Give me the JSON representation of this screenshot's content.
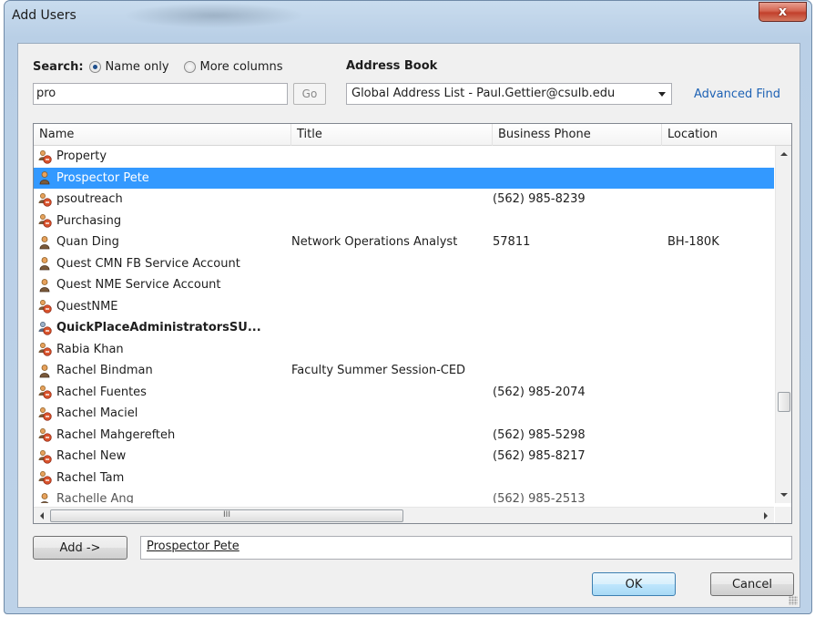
{
  "window": {
    "title": "Add Users",
    "close_label": "x"
  },
  "search": {
    "label": "Search:",
    "option_name_only": "Name only",
    "option_more_columns": "More columns",
    "selected_option": "Name only",
    "value": "pro",
    "go_label": "Go"
  },
  "address_book": {
    "label": "Address Book",
    "value": "Global Address List - Paul.Gettier@csulb.edu",
    "advanced_find": "Advanced Find"
  },
  "table": {
    "columns": [
      "Name",
      "Title",
      "Business Phone",
      "Location"
    ],
    "rows": [
      {
        "name": "Property",
        "title": "",
        "phone": "",
        "location": "",
        "icon": "group-icon",
        "selected": false,
        "bold": false
      },
      {
        "name": "Prospector Pete",
        "title": "",
        "phone": "",
        "location": "",
        "icon": "user-icon",
        "selected": true,
        "bold": false
      },
      {
        "name": "psoutreach",
        "title": "",
        "phone": "(562) 985-8239",
        "location": "",
        "icon": "group-icon",
        "selected": false,
        "bold": false
      },
      {
        "name": "Purchasing",
        "title": "",
        "phone": "",
        "location": "",
        "icon": "group-icon",
        "selected": false,
        "bold": false
      },
      {
        "name": "Quan Ding",
        "title": "Network Operations Analyst",
        "phone": "57811",
        "location": "BH-180K",
        "icon": "user-icon",
        "selected": false,
        "bold": false
      },
      {
        "name": "Quest CMN FB Service Account",
        "title": "",
        "phone": "",
        "location": "",
        "icon": "user-icon",
        "selected": false,
        "bold": false
      },
      {
        "name": "Quest NME Service Account",
        "title": "",
        "phone": "",
        "location": "",
        "icon": "user-icon",
        "selected": false,
        "bold": false
      },
      {
        "name": "QuestNME",
        "title": "",
        "phone": "",
        "location": "",
        "icon": "group-icon",
        "selected": false,
        "bold": false
      },
      {
        "name": "QuickPlaceAdministratorsSU...",
        "title": "",
        "phone": "",
        "location": "",
        "icon": "distribution-list-icon",
        "selected": false,
        "bold": true
      },
      {
        "name": "Rabia Khan",
        "title": "",
        "phone": "",
        "location": "",
        "icon": "group-icon",
        "selected": false,
        "bold": false
      },
      {
        "name": "Rachel Bindman",
        "title": "Faculty Summer Session-CED",
        "phone": "",
        "location": "",
        "icon": "user-icon",
        "selected": false,
        "bold": false
      },
      {
        "name": "Rachel Fuentes",
        "title": "",
        "phone": "(562) 985-2074",
        "location": "",
        "icon": "group-icon",
        "selected": false,
        "bold": false
      },
      {
        "name": "Rachel Maciel",
        "title": "",
        "phone": "",
        "location": "",
        "icon": "group-icon",
        "selected": false,
        "bold": false
      },
      {
        "name": "Rachel Mahgerefteh",
        "title": "",
        "phone": "(562) 985-5298",
        "location": "",
        "icon": "group-icon",
        "selected": false,
        "bold": false
      },
      {
        "name": "Rachel New",
        "title": "",
        "phone": "(562) 985-8217",
        "location": "",
        "icon": "group-icon",
        "selected": false,
        "bold": false
      },
      {
        "name": "Rachel Tam",
        "title": "",
        "phone": "",
        "location": "",
        "icon": "group-icon",
        "selected": false,
        "bold": false
      },
      {
        "name": "Rachelle Ang",
        "title": "",
        "phone": "(562) 985-2513",
        "location": "",
        "icon": "user-icon",
        "selected": false,
        "bold": false
      }
    ]
  },
  "hscroll_grip": "III",
  "add": {
    "button_label": "Add ->",
    "value": "Prospector Pete"
  },
  "buttons": {
    "ok": "OK",
    "cancel": "Cancel"
  },
  "colors": {
    "selection": "#3399ff",
    "link": "#1e62b4",
    "group_icon": "#d9532c",
    "user_icon": "#c9782a"
  }
}
